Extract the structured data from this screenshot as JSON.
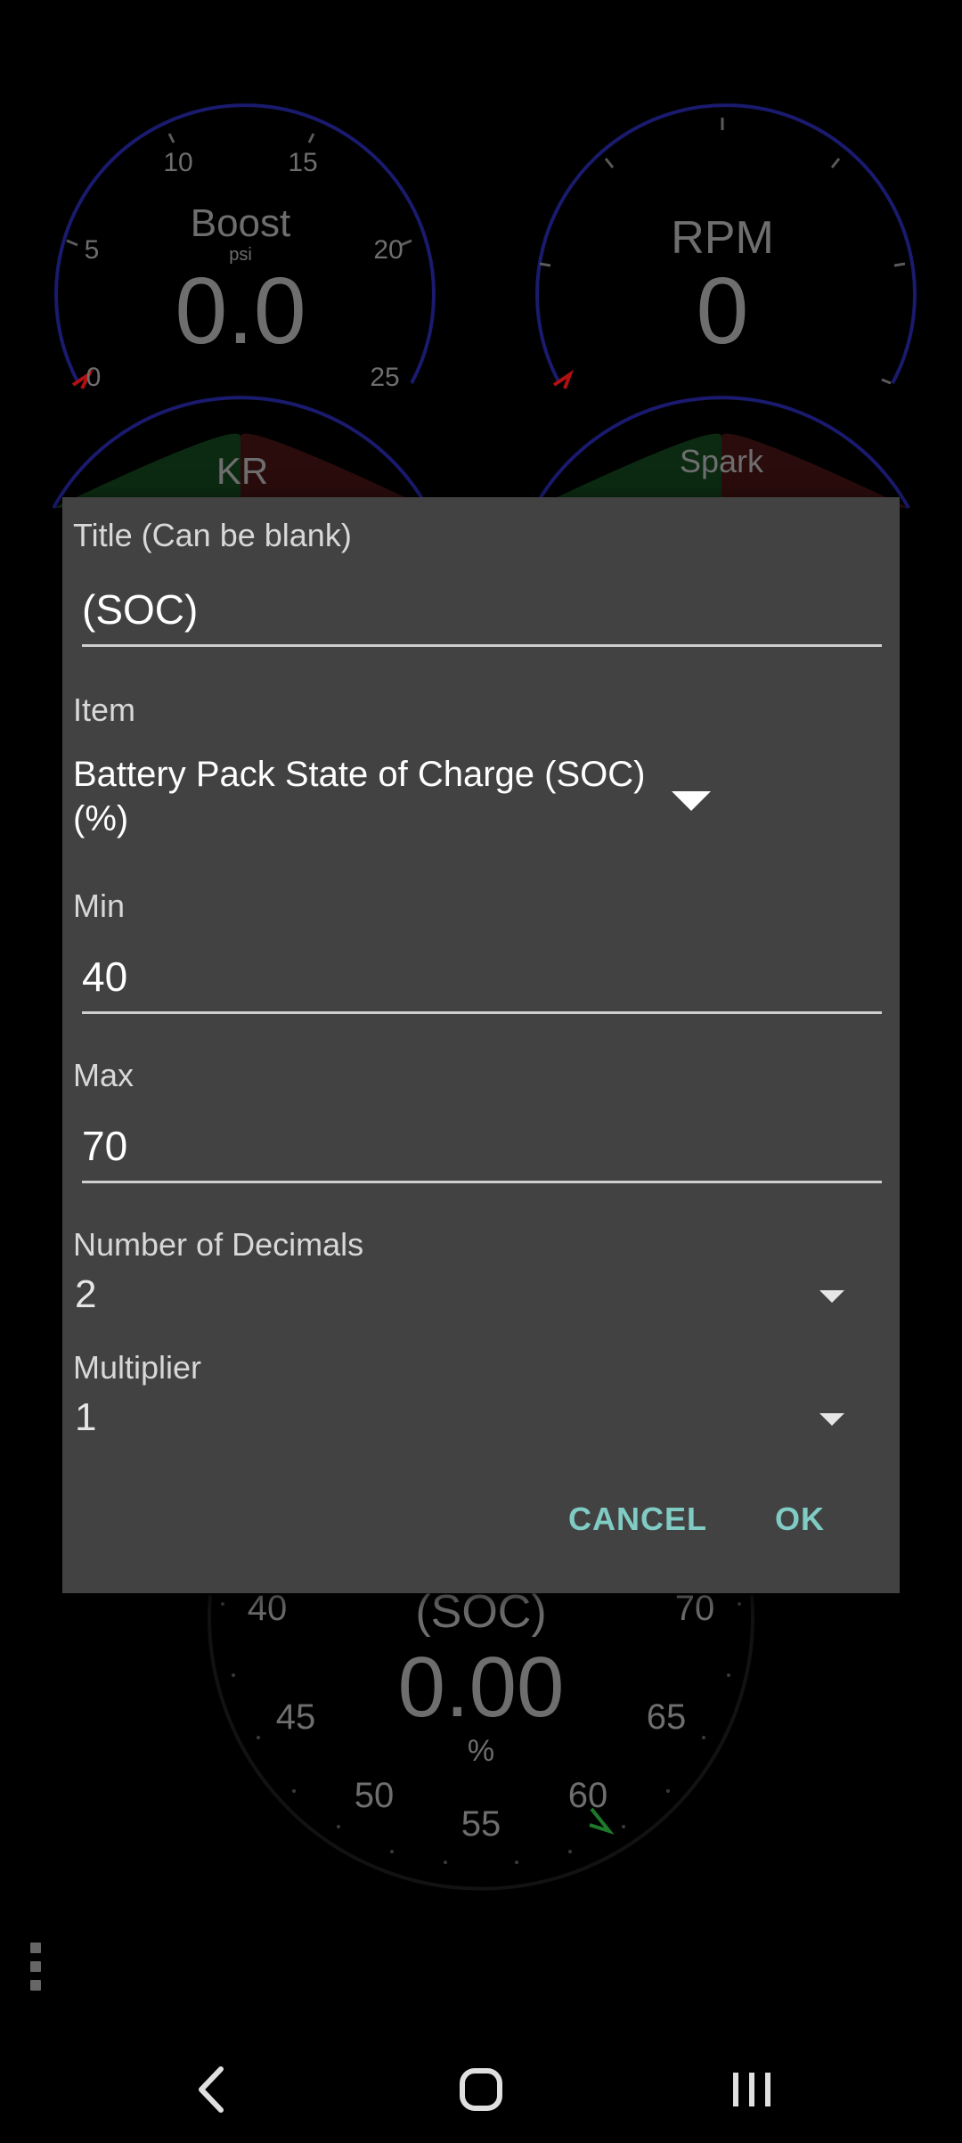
{
  "background": {
    "boost_gauge": {
      "title": "Boost",
      "unit": "psi",
      "value": "0.0",
      "ticks": [
        "0",
        "5",
        "10",
        "15",
        "20",
        "25"
      ]
    },
    "rpm_gauge": {
      "title": "RPM",
      "value": "0"
    },
    "kr_gauge": {
      "title": "KR"
    },
    "spark_gauge": {
      "title": "Spark"
    },
    "soc_gauge": {
      "title": "(SOC)",
      "value": "0.00",
      "unit": "%",
      "ticks": [
        "40",
        "45",
        "50",
        "55",
        "60",
        "65",
        "70"
      ]
    }
  },
  "dialog": {
    "title_label": "Title (Can be blank)",
    "title_value": "(SOC)",
    "item_label": "Item",
    "item_value": "Battery Pack State of Charge (SOC) (%)",
    "min_label": "Min",
    "min_value": "40",
    "max_label": "Max",
    "max_value": "70",
    "decimals_label": "Number of Decimals",
    "decimals_value": "2",
    "multiplier_label": "Multiplier",
    "multiplier_value": "1",
    "cancel_label": "CANCEL",
    "ok_label": "OK"
  },
  "colors": {
    "dialog_bg": "#424242",
    "accent": "#80cbc4",
    "gauge_ring": "#1a1a6e",
    "gauge_text": "#6e6e6e"
  },
  "icons": {
    "overflow": "more-vert-icon",
    "back": "back-icon",
    "home": "home-icon",
    "recents": "recents-icon"
  }
}
